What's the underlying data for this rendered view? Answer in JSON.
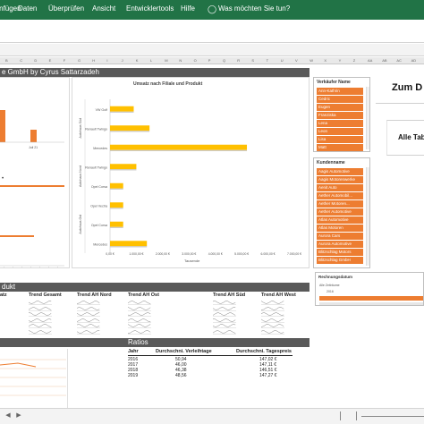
{
  "menu": {
    "items": [
      "Einfügen",
      "Daten",
      "Überprüfen",
      "Ansicht",
      "Entwicklertools",
      "Hilfe"
    ],
    "tell_me": "Was möchten Sie tun?"
  },
  "columns": [
    "B",
    "C",
    "D",
    "E",
    "F",
    "G",
    "H",
    "I",
    "J",
    "K",
    "L",
    "M",
    "N",
    "O",
    "P",
    "Q",
    "R",
    "S",
    "T",
    "U",
    "V",
    "W",
    "X",
    "Y",
    "Z",
    "AA",
    "AB",
    "AC",
    "AD"
  ],
  "dashboard": {
    "title": "e GmbH by Cyrus Sattarzadeh",
    "right_header": "Zum D",
    "right_button": "Alle Tab"
  },
  "chart_left": {
    "x_tick": "Juli 21",
    "x_ticks": [
      "·",
      "·",
      "·",
      "·",
      "·",
      "·",
      "·"
    ]
  },
  "chart_main": {
    "title": "Umsatz nach Filiale und Produkt",
    "x_axis_label": "Tausende",
    "x_ticks": [
      "0,00 €",
      "1.000,00 €",
      "2.000,00 €",
      "3.000,00 €",
      "4.000,00 €",
      "5.000,00 €",
      "6.000,00 €",
      "7.000,00 €"
    ],
    "group_labels": [
      "Autohaus Süd",
      "Autohaus Nord",
      "Autohaus Ost"
    ],
    "bar_labels": [
      "VW Golf",
      "Renault Twingo",
      "Mercedes",
      "Renault Twingo",
      "Opel Corsa",
      "Opel Vectra",
      "Opel Corsa",
      "Mercedes"
    ]
  },
  "chart_data": {
    "type": "bar",
    "title": "Umsatz nach Filiale und Produkt",
    "xlabel": "Tausende",
    "categories": [
      "VW Golf",
      "Renault Twingo",
      "Mercedes",
      "Renault Twingo",
      "Opel Corsa",
      "Opel Vectra",
      "Opel Corsa",
      "Mercedes"
    ],
    "groups": [
      {
        "name": "Autohaus Süd",
        "categories": [
          "VW Golf",
          "Renault Twingo",
          "Mercedes"
        ]
      },
      {
        "name": "Autohaus Nord",
        "categories": [
          "Renault Twingo",
          "Opel Corsa"
        ]
      },
      {
        "name": "Autohaus Ost",
        "categories": [
          "Opel Vectra",
          "Opel Corsa",
          "Mercedes"
        ]
      }
    ],
    "values": [
      900,
      1500,
      5200,
      1000,
      500,
      500,
      500,
      1400
    ],
    "xlim": [
      0,
      7000
    ],
    "color": "#ffc000"
  },
  "slicer_sellers": {
    "title": "Verkäufer Name",
    "items": [
      "Ann-Kathrin",
      "Cedric",
      "Eugen",
      "Franziska",
      "Lena",
      "Leon",
      "Lisa",
      "Matt"
    ]
  },
  "slicer_customers": {
    "title": "Kundenname",
    "items": [
      "Aagis Automotive",
      "Aagis Motorenwerke",
      "Aenit Auto",
      "Aether Automobil...",
      "Aether Motoren...",
      "Aether Automotive",
      "Atlas Automotive",
      "Atlas Motoren",
      "Aurora Cars",
      "Aurora Automotive",
      "Blitzschlag Motors",
      "Blitzschlag GmbH",
      "Borealis Automobil..."
    ]
  },
  "timeline": {
    "title": "Rechnungsdatum",
    "label": "Alle Zeiträume",
    "year": "2016",
    "months": [
      "",
      "",
      "",
      "",
      "",
      "",
      "",
      "",
      "",
      "",
      "",
      "",
      "",
      ""
    ]
  },
  "section_product": {
    "title": "dukt",
    "headers": [
      "atz",
      "Trend Gesamt",
      "Trend AH Nord",
      "Trend AH Ost",
      "Trend AH Süd",
      "Trend AH West"
    ]
  },
  "section_ratios": {
    "title": "Ratios",
    "headers": [
      "Jahr",
      "Durchschni. Verleihtage",
      "Durchschni. Tagespreis"
    ],
    "rows": [
      [
        "2016",
        "50,94",
        "147,02 €"
      ],
      [
        "2017",
        "46,00",
        "147,11 €"
      ],
      [
        "2018",
        "46,38",
        "146,51 €"
      ],
      [
        "2019",
        "48,56",
        "147,27 €"
      ]
    ]
  },
  "colors": {
    "ribbon": "#217346",
    "accent_orange": "#ed7d31",
    "bar_yellow": "#ffc000",
    "dark_bar": "#595959"
  }
}
